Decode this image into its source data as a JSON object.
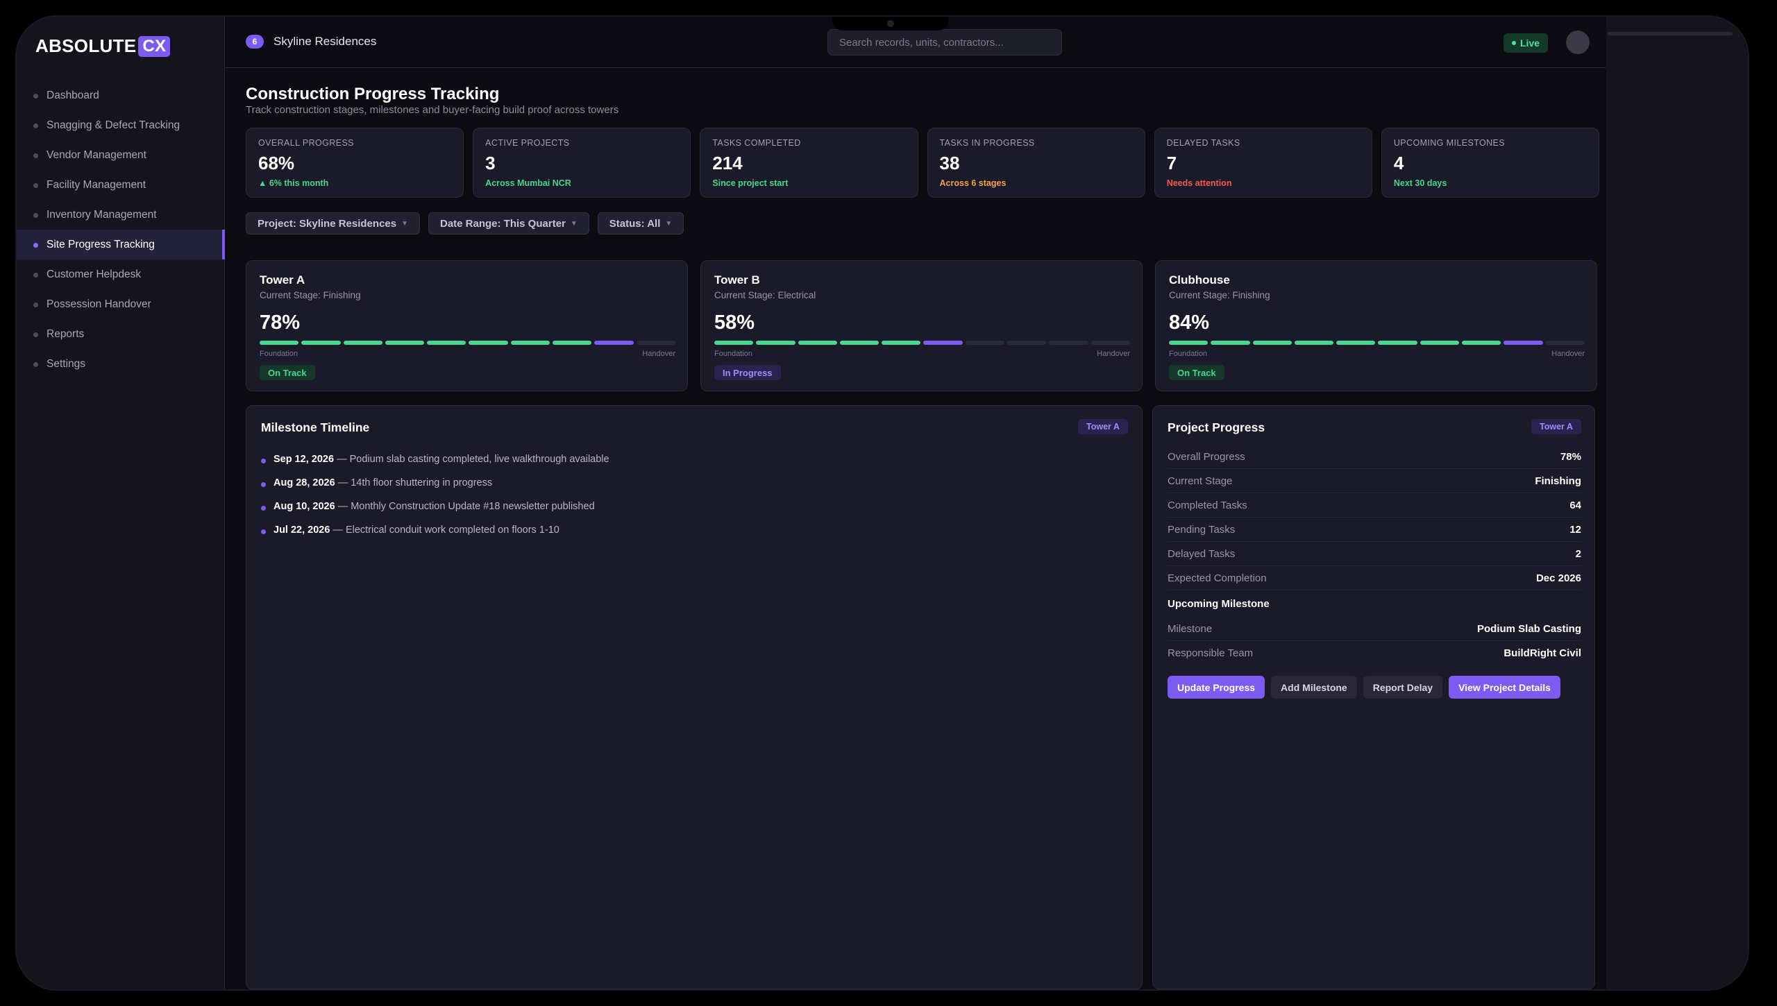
{
  "brand": {
    "name": "ABSOLUTE",
    "suffix": "CX"
  },
  "sidebar": {
    "items": [
      {
        "label": "Dashboard",
        "active": false
      },
      {
        "label": "Snagging & Defect Tracking",
        "active": false
      },
      {
        "label": "Vendor Management",
        "active": false
      },
      {
        "label": "Facility Management",
        "active": false
      },
      {
        "label": "Inventory Management",
        "active": false
      },
      {
        "label": "Site Progress Tracking",
        "active": true
      },
      {
        "label": "Customer Helpdesk",
        "active": false
      },
      {
        "label": "Possession Handover",
        "active": false
      },
      {
        "label": "Reports",
        "active": false
      },
      {
        "label": "Settings",
        "active": false
      }
    ]
  },
  "header": {
    "project_count": "6",
    "project_name": "Skyline Residences",
    "search_placeholder": "Search records, units, contractors...",
    "live_label": "Live"
  },
  "page": {
    "title": "Construction Progress Tracking",
    "subtitle": "Track construction stages, milestones and buyer-facing build proof across towers"
  },
  "stats": [
    {
      "label": "OVERALL PROGRESS",
      "value": "68%",
      "sub": "▲ 6% this month",
      "tone": "green"
    },
    {
      "label": "ACTIVE PROJECTS",
      "value": "3",
      "sub": "Across Mumbai NCR",
      "tone": "green"
    },
    {
      "label": "TASKS COMPLETED",
      "value": "214",
      "sub": "Since project start",
      "tone": "green"
    },
    {
      "label": "TASKS IN PROGRESS",
      "value": "38",
      "sub": "Across 6 stages",
      "tone": "amber"
    },
    {
      "label": "DELAYED TASKS",
      "value": "7",
      "sub": "Needs attention",
      "tone": "red"
    },
    {
      "label": "UPCOMING MILESTONES",
      "value": "4",
      "sub": "Next 30 days",
      "tone": "green"
    }
  ],
  "filters": [
    {
      "label": "Project: Skyline Residences"
    },
    {
      "label": "Date Range: This Quarter"
    },
    {
      "label": "Status: All"
    }
  ],
  "towers": [
    {
      "name": "Tower A",
      "stage": "Current Stage: Finishing",
      "percent": "78%",
      "stages_done": 8,
      "current_stage_index": 8,
      "stages_total": 10,
      "start_label": "Foundation",
      "end_label": "Handover",
      "status": "On Track",
      "status_tone": "ok"
    },
    {
      "name": "Tower B",
      "stage": "Current Stage: Electrical",
      "percent": "58%",
      "stages_done": 5,
      "current_stage_index": 5,
      "stages_total": 10,
      "start_label": "Foundation",
      "end_label": "Handover",
      "status": "In Progress",
      "status_tone": "prog"
    },
    {
      "name": "Clubhouse",
      "stage": "Current Stage: Finishing",
      "percent": "84%",
      "stages_done": 8,
      "current_stage_index": 8,
      "stages_total": 10,
      "start_label": "Foundation",
      "end_label": "Handover",
      "status": "On Track",
      "status_tone": "ok"
    }
  ],
  "timeline": {
    "title": "Milestone Timeline",
    "tag": "Tower A",
    "items": [
      {
        "date": "Sep 12, 2026",
        "text": "— Podium slab casting completed, live walkthrough available"
      },
      {
        "date": "Aug 28, 2026",
        "text": "— 14th floor shuttering in progress"
      },
      {
        "date": "Aug 10, 2026",
        "text": "— Monthly Construction Update #18 newsletter published"
      },
      {
        "date": "Jul 22, 2026",
        "text": "— Electrical conduit work completed on floors 1-10"
      }
    ]
  },
  "project_progress": {
    "title": "Project Progress",
    "tag": "Tower A",
    "rows": [
      {
        "key": "Overall Progress",
        "value": "78%"
      },
      {
        "key": "Current Stage",
        "value": "Finishing"
      },
      {
        "key": "Completed Tasks",
        "value": "64"
      },
      {
        "key": "Pending Tasks",
        "value": "12"
      },
      {
        "key": "Delayed Tasks",
        "value": "2"
      },
      {
        "key": "Expected Completion",
        "value": "Dec 2026"
      }
    ],
    "upcoming_heading": "Upcoming Milestone",
    "upcoming_rows": [
      {
        "key": "Milestone",
        "value": "Podium Slab Casting"
      },
      {
        "key": "Responsible Team",
        "value": "BuildRight Civil"
      }
    ],
    "actions": {
      "update": "Update Progress",
      "add": "Add Milestone",
      "delay": "Report Delay",
      "view": "View Project Details"
    }
  },
  "colors": {
    "accent": "#7c5cf0",
    "success": "#48d690",
    "warning": "#f5a34a",
    "danger": "#f05a5a"
  }
}
